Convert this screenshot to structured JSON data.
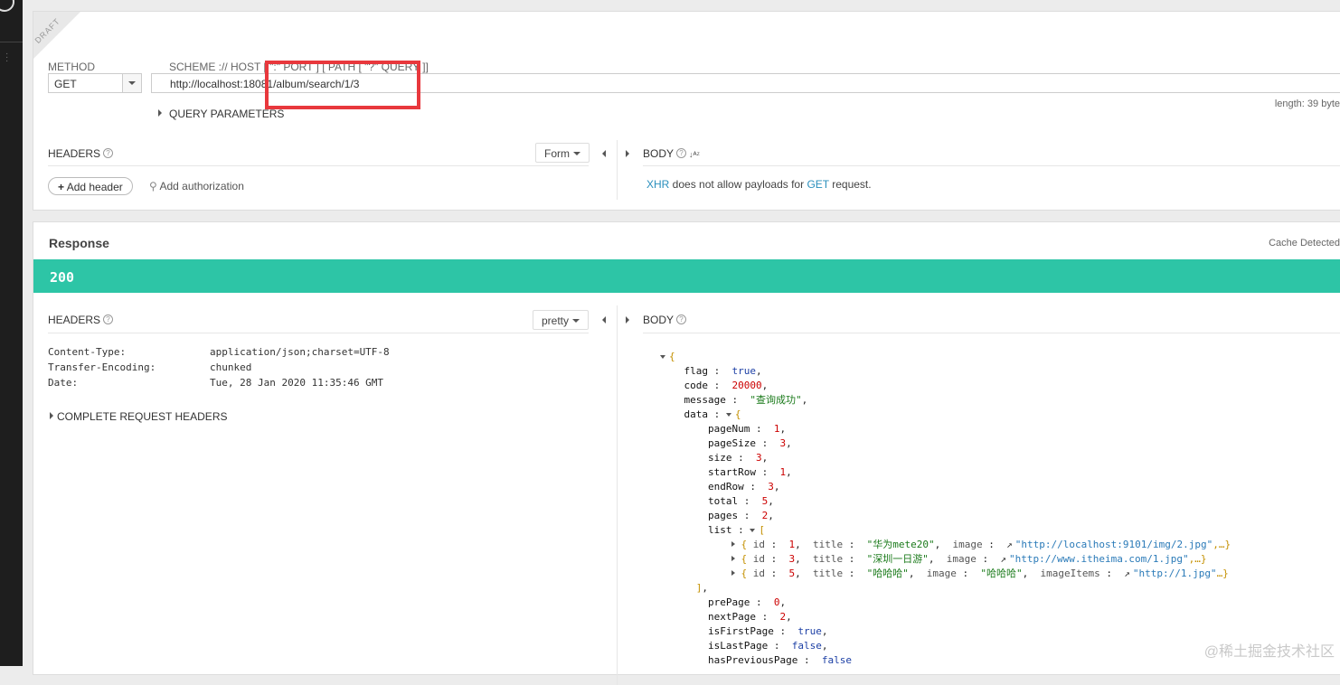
{
  "request": {
    "draft_label": "DRAFT",
    "method_label": "METHOD",
    "method_value": "GET",
    "url_label": "SCHEME :// HOST [ \":\" PORT ] [ PATH [ \"?\" QUERY ]]",
    "url_value": "http://localhost:18081/album/search/1/3",
    "length_text": "length: 39 byte",
    "query_params_label": "QUERY PARAMETERS",
    "headers_label": "HEADERS",
    "form_dropdown": "Form",
    "add_header_label": "Add header",
    "add_auth_label": "Add authorization",
    "body_label": "BODY",
    "body_note_xhr": "XHR",
    "body_note_mid": " does not allow payloads for ",
    "body_note_get": "GET",
    "body_note_end": " request."
  },
  "response": {
    "title": "Response",
    "cache_text": "Cache Detected",
    "status_code": "200",
    "headers_label": "HEADERS",
    "pretty_dropdown": "pretty",
    "body_label": "BODY",
    "headers": [
      {
        "name": "Content-Type:",
        "value": "application/json;charset=UTF-8"
      },
      {
        "name": "Transfer-Encoding:",
        "value": "chunked"
      },
      {
        "name": "Date:",
        "value": "Tue, 28 Jan 2020 11:35:46 GMT"
      }
    ],
    "complete_headers_label": "COMPLETE REQUEST HEADERS",
    "json": {
      "flag": "true",
      "code": "20000",
      "message": "\"查询成功\"",
      "data": {
        "pageNum": "1",
        "pageSize": "3",
        "size": "3",
        "startRow": "1",
        "endRow": "3",
        "total": "5",
        "pages": "2",
        "list_items": [
          {
            "id": "1",
            "title": "\"华为mete20\"",
            "image_key": "image",
            "image": "\"http://localhost:9101/img/2.jpg\"",
            "tail": ",…}"
          },
          {
            "id": "3",
            "title": "\"深圳一日游\"",
            "image_key": "image",
            "image": "\"http://www.itheima.com/1.jpg\"",
            "tail": ",…}"
          },
          {
            "id": "5",
            "title": "\"哈哈哈\"",
            "image_key": "image",
            "image_plain": "\"哈哈哈\"",
            "image_items_key": "imageItems",
            "image_items": "\"http://1.jpg\"",
            "tail": "…}"
          }
        ],
        "prePage": "0",
        "nextPage": "2",
        "isFirstPage": "true",
        "isLastPage": "false",
        "hasPreviousPage": "false"
      }
    }
  },
  "watermark": "@稀土掘金技术社区"
}
